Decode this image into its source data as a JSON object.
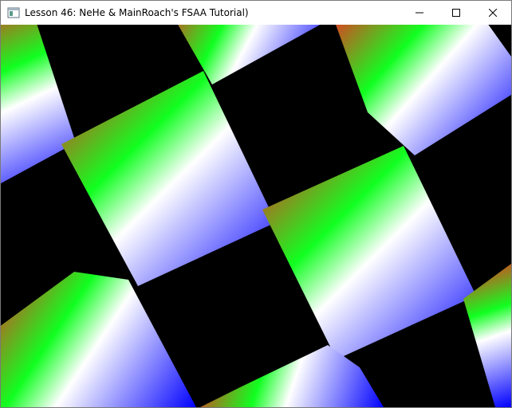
{
  "window": {
    "title": "Lesson 46: NeHe & MainRoach's FSAA Tutorial)",
    "background_color": "#000000",
    "controls": {
      "minimize_icon": "minimize-icon",
      "maximize_icon": "maximize-icon",
      "close_icon": "close-icon"
    }
  },
  "scene": {
    "colors": {
      "red": "#ff2020",
      "green": "#10ff20",
      "blue": "#0000ff",
      "white": "#ffffff"
    },
    "quad_count": 10
  }
}
